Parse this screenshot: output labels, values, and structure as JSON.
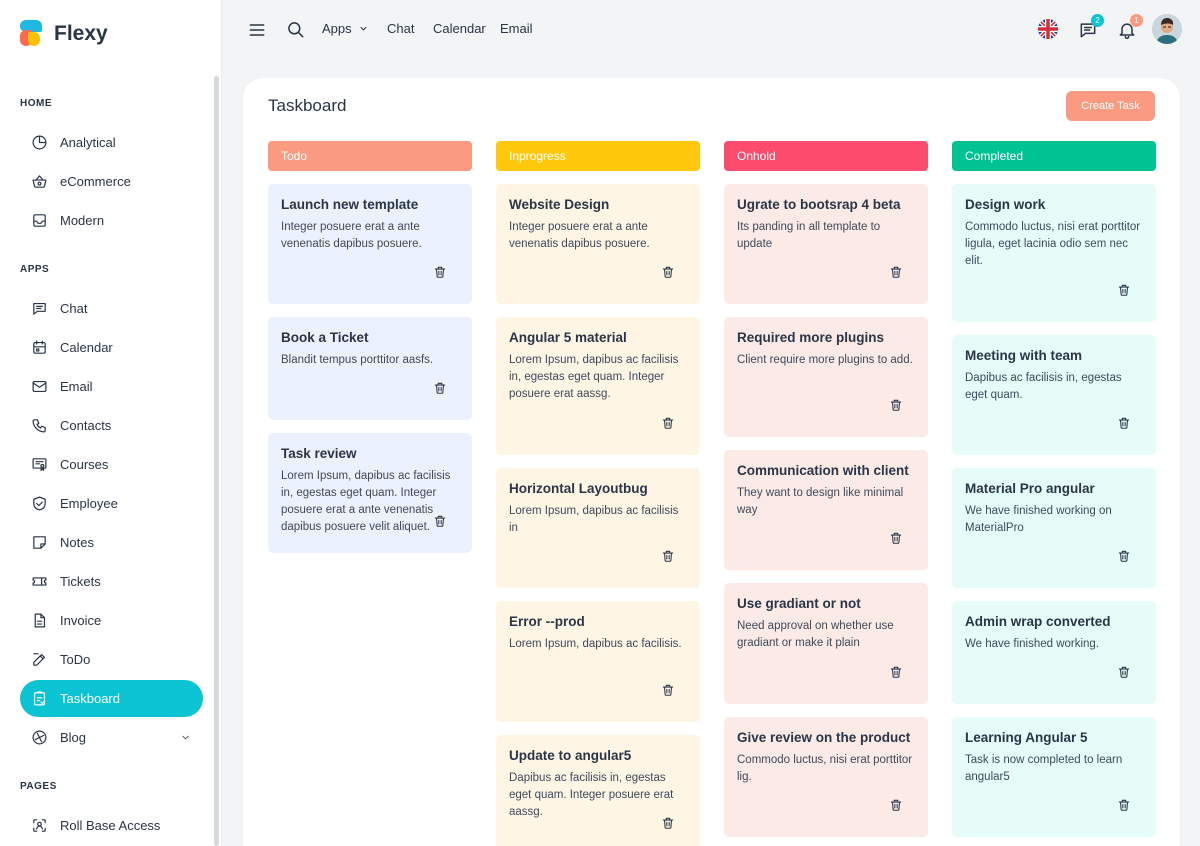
{
  "brand": {
    "name": "Flexy"
  },
  "sidebar": {
    "sections": [
      {
        "label": "HOME"
      },
      {
        "label": "APPS"
      },
      {
        "label": "PAGES"
      }
    ],
    "items": [
      {
        "label": "Analytical",
        "icon": "chart-pie-icon"
      },
      {
        "label": "eCommerce",
        "icon": "basket-icon"
      },
      {
        "label": "Modern",
        "icon": "inbox-icon"
      },
      {
        "label": "Chat",
        "icon": "message-icon"
      },
      {
        "label": "Calendar",
        "icon": "calendar-icon"
      },
      {
        "label": "Email",
        "icon": "mail-icon"
      },
      {
        "label": "Contacts",
        "icon": "phone-icon"
      },
      {
        "label": "Courses",
        "icon": "certificate-icon"
      },
      {
        "label": "Employee",
        "icon": "shield-icon"
      },
      {
        "label": "Notes",
        "icon": "note-icon"
      },
      {
        "label": "Tickets",
        "icon": "ticket-icon"
      },
      {
        "label": "Invoice",
        "icon": "file-icon"
      },
      {
        "label": "ToDo",
        "icon": "edit-icon"
      },
      {
        "label": "Taskboard",
        "icon": "clipboard-icon",
        "active": true
      },
      {
        "label": "Blog",
        "icon": "globe-icon"
      },
      {
        "label": "Roll Base Access",
        "icon": "scan-icon"
      }
    ]
  },
  "topbar": {
    "links": [
      "Apps",
      "Chat",
      "Calendar",
      "Email"
    ],
    "messages_badge": "2",
    "notifications_badge": "1",
    "colors": {
      "messages": "#0cc3d3",
      "notifications": "#fa9a80"
    }
  },
  "taskboard": {
    "title": "Taskboard",
    "create_label": "Create Task",
    "columns": [
      {
        "name": "Todo",
        "color": "#fa9a80",
        "card_bg": "#ebf1fd",
        "tasks": [
          {
            "title": "Launch new template",
            "desc": "Integer posuere erat a ante venenatis dapibus posuere."
          },
          {
            "title": "Book a Ticket",
            "desc": "Blandit tempus porttitor aasfs."
          },
          {
            "title": "Task review",
            "desc": "Lorem Ipsum, dapibus ac facilisis in, egestas eget quam. Integer posuere erat a ante venenatis dapibus posuere velit aliquet."
          }
        ]
      },
      {
        "name": "Inprogress",
        "color": "#ffc80d",
        "card_bg": "#fef5e5",
        "tasks": [
          {
            "title": "Website Design",
            "desc": "Integer posuere erat a ante venenatis dapibus posuere."
          },
          {
            "title": "Angular 5 material",
            "desc": "Lorem Ipsum, dapibus ac facilisis in, egestas eget quam. Integer posuere erat aassg."
          },
          {
            "title": "Horizontal Layoutbug",
            "desc": "Lorem Ipsum, dapibus ac facilisis in"
          },
          {
            "title": "Error --prod",
            "desc": "Lorem Ipsum, dapibus ac facilisis."
          },
          {
            "title": "Update to angular5",
            "desc": "Dapibus ac facilisis in, egestas eget quam. Integer posuere erat aassg."
          }
        ]
      },
      {
        "name": "Onhold",
        "color": "#fc4b6c",
        "card_bg": "#fbeae6",
        "tasks": [
          {
            "title": "Ugrate to bootsrap 4 beta",
            "desc": "Its panding in all template to update"
          },
          {
            "title": "Required more plugins",
            "desc": "Client require more plugins to add."
          },
          {
            "title": "Communication with client",
            "desc": "They want to design like minimal way"
          },
          {
            "title": "Use gradiant or not",
            "desc": "Need approval on whether use gradiant or make it plain"
          },
          {
            "title": "Give review on the product",
            "desc": "Commodo luctus, nisi erat porttitor lig."
          }
        ]
      },
      {
        "name": "Completed",
        "color": "#00c292",
        "card_bg": "#e6fcf8",
        "tasks": [
          {
            "title": "Design work",
            "desc": "Commodo luctus, nisi erat porttitor ligula, eget lacinia odio sem nec elit."
          },
          {
            "title": "Meeting with team",
            "desc": "Dapibus ac facilisis in, egestas eget quam."
          },
          {
            "title": "Material Pro angular",
            "desc": "We have finished working on MaterialPro"
          },
          {
            "title": "Admin wrap converted",
            "desc": "We have finished working."
          },
          {
            "title": "Learning Angular 5",
            "desc": "Task is now completed to learn angular5"
          }
        ]
      }
    ]
  }
}
